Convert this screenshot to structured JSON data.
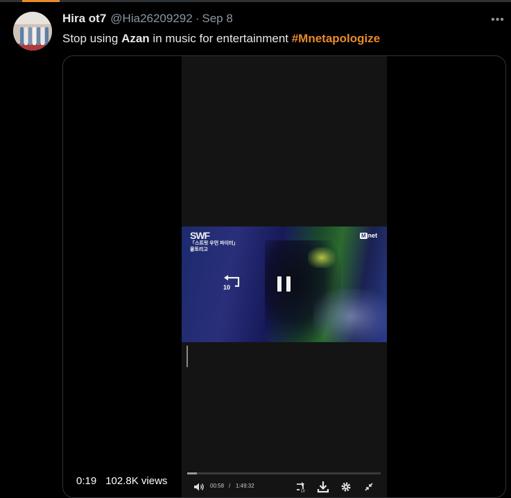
{
  "tweet": {
    "author_name": "Hira ot7",
    "handle": "@Hia26209292",
    "separator": "·",
    "date": "Sep 8",
    "more_glyph": "•••",
    "text_before": "Stop using ",
    "text_bold": "Azan",
    "text_after": " in music for entertainment ",
    "hashtag": "#Mnetapologize"
  },
  "video": {
    "show_logo_small": "「스트릿 우먼 파이터」",
    "show_logo_big": "SWF",
    "show_logo_sub": "올토리고",
    "channel_logo_m": "M",
    "channel_logo_rest": "net",
    "rewind_label": "10",
    "player_current_time": "00:58",
    "player_time_separator": "/",
    "player_total_time": "1:49:32",
    "player_progress_fraction": 0.05,
    "elapsed": "0:19",
    "views": "102.8K views"
  },
  "colors": {
    "accent": "#e98a2a",
    "text_primary": "#e7e9ea",
    "text_secondary": "#8b98a5"
  }
}
